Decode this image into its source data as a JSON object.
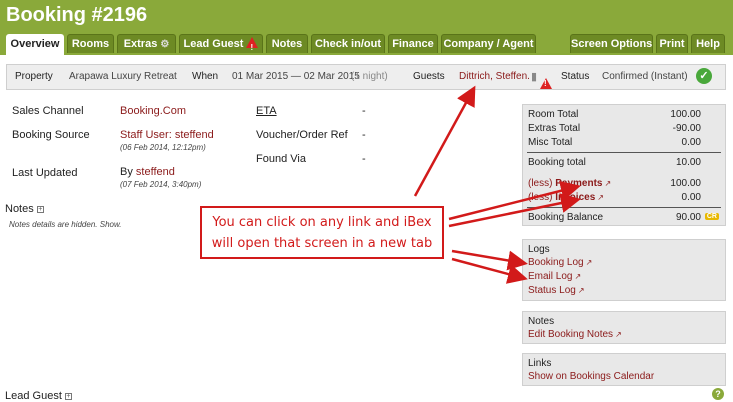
{
  "header": {
    "title": "Booking #2196"
  },
  "tabs": [
    {
      "label": "Overview"
    },
    {
      "label": "Rooms"
    },
    {
      "label": "Extras"
    },
    {
      "label": "Lead Guest"
    },
    {
      "label": "Notes"
    },
    {
      "label": "Check in/out"
    },
    {
      "label": "Finance"
    },
    {
      "label": "Company / Agent"
    },
    {
      "label": "Screen Options"
    },
    {
      "label": "Print"
    },
    {
      "label": "Help"
    }
  ],
  "infobar": {
    "property_label": "Property",
    "property_value": "Arapawa Luxury Retreat",
    "when_label": "When",
    "when_value": "01 Mar 2015 — 02 Mar 2015",
    "nights": "(1 night)",
    "guests_label": "Guests",
    "guests_value": "Dittrich, Steffen.",
    "status_label": "Status",
    "status_value": "Confirmed (Instant)"
  },
  "details": {
    "sales_channel_label": "Sales Channel",
    "sales_channel_value": "Booking.Com",
    "booking_source_label": "Booking Source",
    "booking_source_value": "Staff User: steffend",
    "booking_source_date": "(06 Feb 2014, 12:12pm)",
    "last_updated_label": "Last Updated",
    "last_updated_by": "By",
    "last_updated_user": "steffend",
    "last_updated_date": "(07 Feb 2014, 3:40pm)",
    "eta_label": "ETA",
    "eta_value": "-",
    "voucher_label": "Voucher/Order Ref",
    "voucher_value": "-",
    "found_via_label": "Found Via",
    "found_via_value": "-"
  },
  "notes": {
    "label": "Notes",
    "hidden_text": "Notes details are hidden.",
    "show_link": "Show."
  },
  "lead_guest": {
    "label": "Lead Guest"
  },
  "totals": {
    "room_total_label": "Room Total",
    "room_total": "100.00",
    "extras_total_label": "Extras Total",
    "extras_total": "-90.00",
    "misc_total_label": "Misc Total",
    "misc_total": "0.00",
    "booking_total_label": "Booking total",
    "booking_total": "10.00",
    "less": "(less)",
    "payments_label": "Payments",
    "payments": "100.00",
    "invoices_label": "Invoices",
    "invoices": "0.00",
    "balance_label": "Booking Balance",
    "balance": "90.00",
    "balance_badge": "CR"
  },
  "logs": {
    "title": "Logs",
    "booking_log": "Booking Log",
    "email_log": "Email Log",
    "status_log": "Status Log"
  },
  "notes_panel": {
    "title": "Notes",
    "edit_link": "Edit Booking Notes"
  },
  "links_panel": {
    "title": "Links",
    "calendar_link": "Show on Bookings Calendar"
  },
  "callout": {
    "line1": "You can click on any link and iBex",
    "line2": "will open that screen in a new tab"
  },
  "colors": {
    "header": "#8aa93a",
    "tab": "#6d8a24",
    "link": "#8b1a1a",
    "annotation": "#d21a1a"
  }
}
